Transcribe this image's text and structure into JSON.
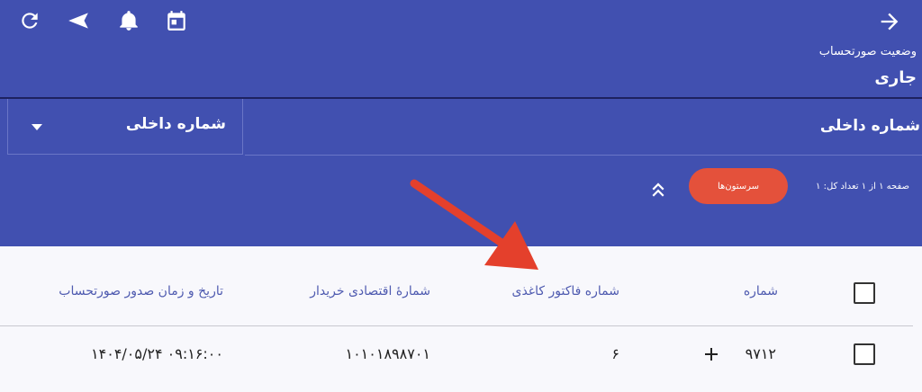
{
  "header": {
    "status_label": "وضعیت صورتحساب",
    "status_value": "جاری",
    "icons": [
      "refresh-icon",
      "send-icon",
      "bell-icon",
      "calendar-icon",
      "arrow-right-icon"
    ]
  },
  "filter": {
    "field_label": "شماره داخلی",
    "selected_value": "شماره داخلی"
  },
  "toolbar": {
    "paging_text": "صفحه ۱ از ۱   تعداد کل: ۱",
    "columns_button_label": "سرستون‌ها"
  },
  "table": {
    "headers": {
      "number": "شماره",
      "paper_invoice_number": "شماره فاکتور کاغذی",
      "buyer_economic_number": "شمارهٔ اقتصادی خریدار",
      "issue_datetime": "تاریخ و زمان صدور صورتحساب"
    },
    "rows": [
      {
        "number": "۹۷۱۲",
        "paper_invoice_number": "۶",
        "buyer_economic_number": "۱۰۱۰۱۸۹۸۷۰۱",
        "issue_datetime": "۱۴۰۴/۰۵/۲۴ ۰۹:۱۶:۰۰"
      }
    ]
  },
  "colors": {
    "primary": "#4150b0",
    "accent": "#e4513b",
    "header_text": "#4f5bb0",
    "annotation_arrow": "#e4402c"
  }
}
